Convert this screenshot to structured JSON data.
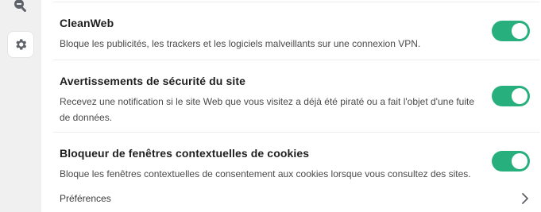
{
  "sidebar": {
    "icons": [
      "zoom-out-icon",
      "gear-icon"
    ]
  },
  "settings": [
    {
      "title": "CleanWeb",
      "description": "Bloque les publicités, les trackers et les logiciels malveillants sur une connexion VPN.",
      "enabled": true
    },
    {
      "title": "Avertissements de sécurité du site",
      "description_line1": "Recevez une notification si le site Web que vous visitez a déjà été piraté ou a fait l'objet d'une fuite",
      "description_line2": "de données.",
      "enabled": true
    },
    {
      "title": "Bloqueur de fenêtres contextuelles de cookies",
      "description": "Bloque les fenêtres contextuelles de consentement aux cookies lorsque vous consultez des sites.",
      "enabled": true
    }
  ],
  "preferences": {
    "label": "Préférences"
  },
  "colors": {
    "toggle_on": "#27b07d",
    "sidebar_bg": "#f0f0f1",
    "icon": "#5f6268"
  }
}
